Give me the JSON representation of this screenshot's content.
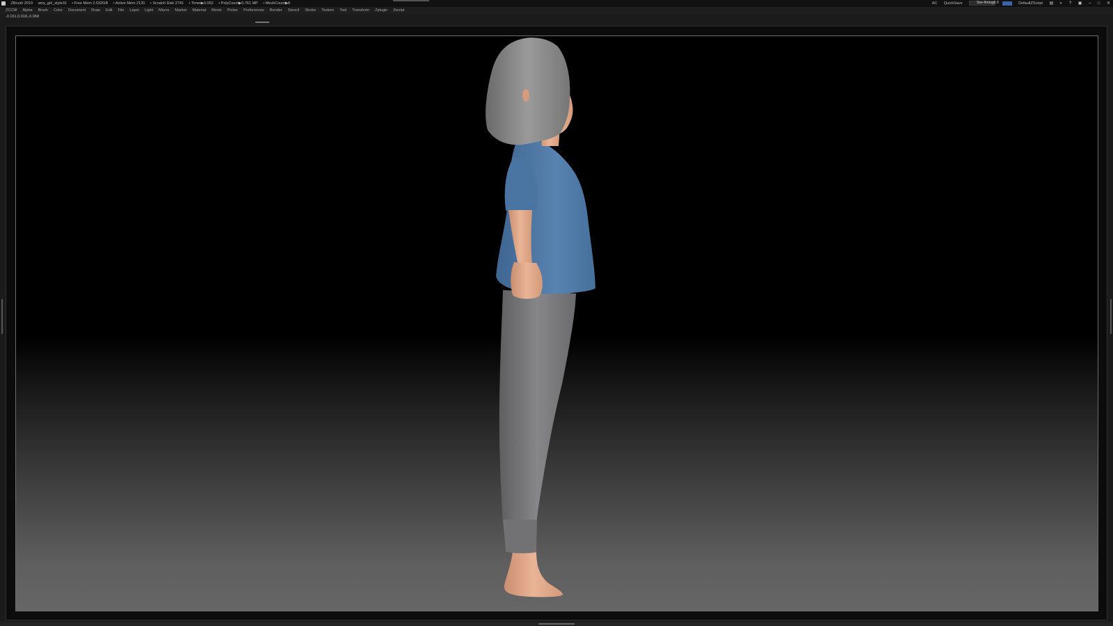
{
  "title_bar": {
    "app_name": "ZBrush 2019",
    "file_name": "amy_girl_style31",
    "free_mem": "• Free Mem 2.532GB",
    "active_mem": "• Active Mem 2120",
    "scratch_disk": "• Scratch Disk 2741",
    "timer": "• Timer▶0.052",
    "polycount": "• PolyCount▶0.761 MP",
    "meshcount": "• MeshCount▶8",
    "ac_label": "AC",
    "quicksave_label": "QuickSave",
    "see_through_label": "See-through 0",
    "see_through_value": 0,
    "script_label": "DefaultZScript"
  },
  "menu": {
    "items": [
      "ZCCW",
      "Alpha",
      "Brush",
      "Color",
      "Document",
      "Draw",
      "Edit",
      "File",
      "Layer",
      "Light",
      "Macro",
      "Marker",
      "Material",
      "Movie",
      "Picker",
      "Preferences",
      "Render",
      "Stencil",
      "Stroke",
      "Texture",
      "Tool",
      "Transform",
      "Zplugin",
      "Zscript"
    ]
  },
  "coordinates": "-0.161,0.018,-0.068",
  "colors": {
    "shirt": "#4f78a6",
    "pants": "#7b7b7d",
    "hair": "#8a8a8a",
    "skin": "#e2a889",
    "menu_accent": "#3a64a6",
    "see_through_fill": "#3bb13b"
  }
}
